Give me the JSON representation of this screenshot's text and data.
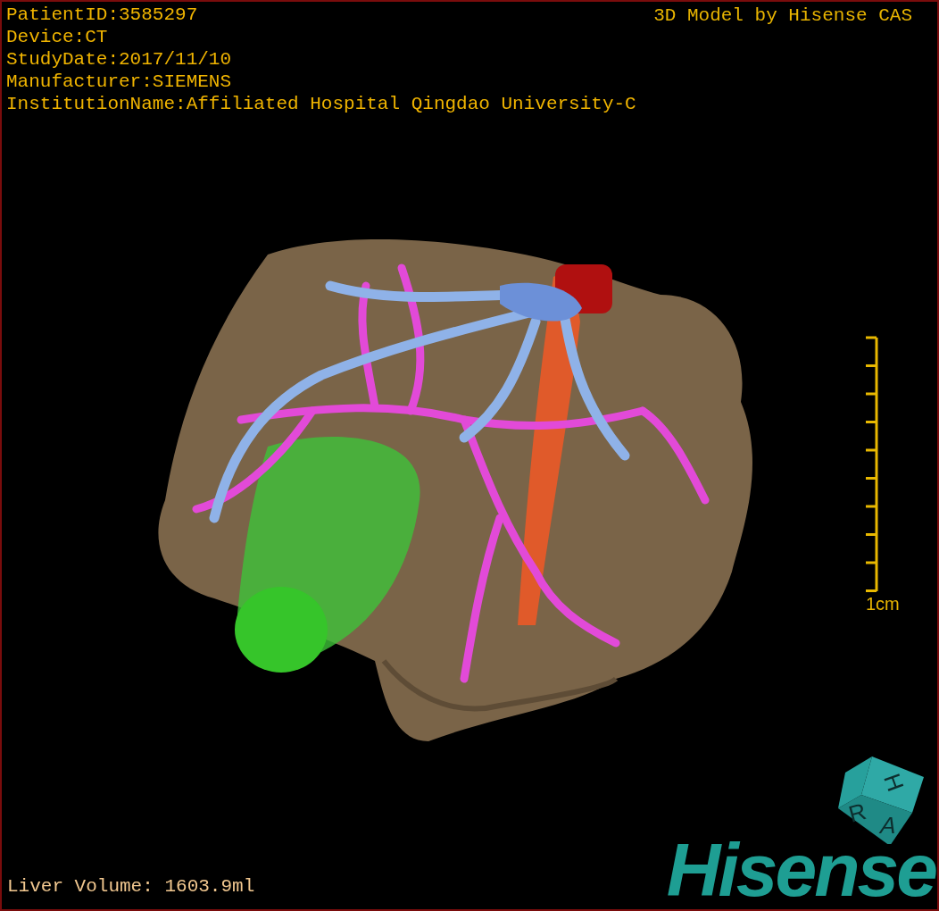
{
  "study_info": [
    "PatientID:3585297",
    "Device:CT",
    "StudyDate:2017/11/10",
    "Manufacturer:SIEMENS",
    "InstitutionName:Affiliated Hospital Qingdao University-C"
  ],
  "credit": "3D Model by Hisense CAS",
  "scale_bar": {
    "label": "1cm"
  },
  "orientation_cube": {
    "faces": [
      "H",
      "R",
      "A"
    ]
  },
  "logo": "Hisense",
  "volume": "Liver Volume: 1603.9ml"
}
